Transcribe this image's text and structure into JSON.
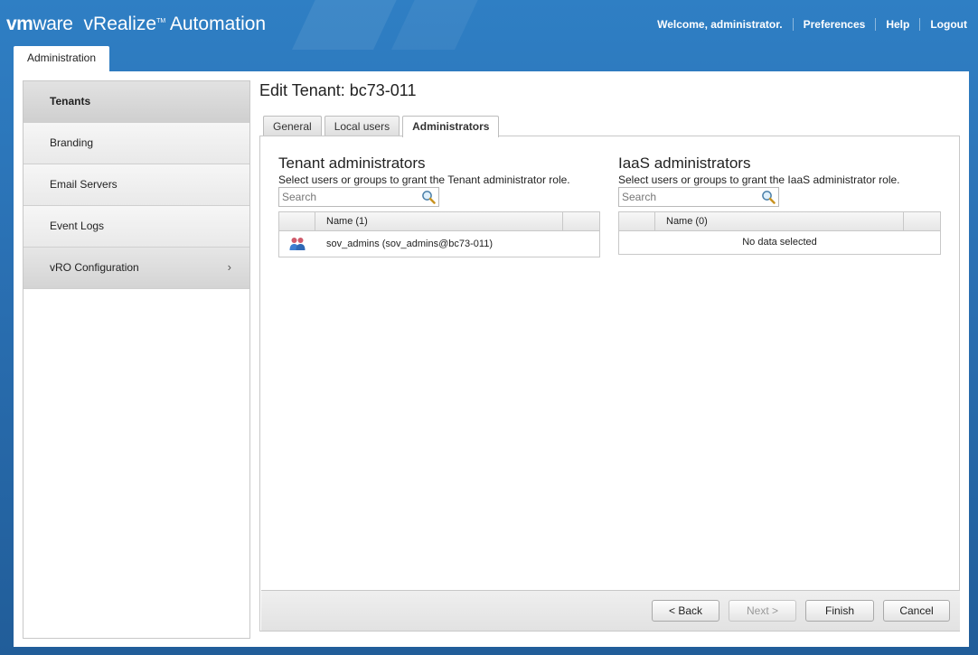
{
  "header": {
    "brand_vm": "vm",
    "brand_ware": "ware",
    "product": "vRealize",
    "product_tm": "TM",
    "product_suffix": "Automation",
    "welcome": "Welcome, administrator.",
    "links": [
      "Preferences",
      "Help",
      "Logout"
    ]
  },
  "main_tab": {
    "label": "Administration"
  },
  "sidebar": {
    "items": [
      {
        "label": "Tenants",
        "active": true
      },
      {
        "label": "Branding"
      },
      {
        "label": "Email Servers"
      },
      {
        "label": "Event Logs"
      },
      {
        "label": "vRO Configuration",
        "chevron": "›"
      }
    ]
  },
  "page": {
    "title": "Edit Tenant: bc73-011",
    "tabs": [
      "General",
      "Local users",
      "Administrators"
    ],
    "active_tab": "Administrators"
  },
  "tenant_admins": {
    "title": "Tenant administrators",
    "description": "Select users or groups to grant the Tenant administrator role.",
    "search_placeholder": "Search",
    "column_name": "Name (1)",
    "rows": [
      {
        "name": "sov_admins (sov_admins@bc73-011)",
        "icon": "user-group-icon"
      }
    ]
  },
  "iaas_admins": {
    "title": "IaaS administrators",
    "description": "Select users or groups to grant the IaaS administrator role.",
    "search_placeholder": "Search",
    "column_name": "Name (0)",
    "empty_text": "No data selected"
  },
  "footer": {
    "back": "< Back",
    "next": "Next >",
    "finish": "Finish",
    "cancel": "Cancel"
  },
  "colors": {
    "header_blue": "#2f7fc4",
    "panel_bg": "#ffffff",
    "border": "#c8c8c8"
  }
}
